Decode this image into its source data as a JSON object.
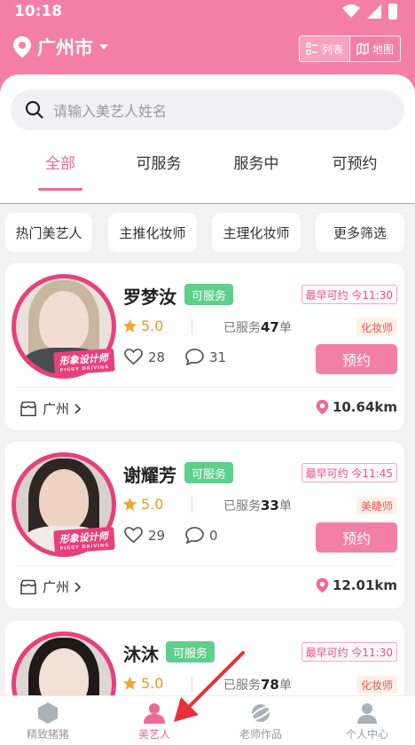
{
  "status_bar": {
    "time": "10:18"
  },
  "header": {
    "city": "广州市",
    "view_toggle": {
      "list_label": "列表",
      "map_label": "地图"
    }
  },
  "search": {
    "placeholder": "请输入美艺人姓名"
  },
  "tabs": [
    {
      "label": "全部",
      "active": true
    },
    {
      "label": "可服务",
      "active": false
    },
    {
      "label": "服务中",
      "active": false
    },
    {
      "label": "可预约",
      "active": false
    }
  ],
  "filters": [
    "热门美艺人",
    "主推化妆师",
    "主理化妆师",
    "更多筛选"
  ],
  "artists": [
    {
      "name": "罗梦汝",
      "status": "可服务",
      "earliest": "最早可约 今11:30",
      "rating": "5.0",
      "served_prefix": "已服务",
      "served_count": "47",
      "served_suffix": "单",
      "role": "化妆师",
      "likes": "28",
      "comments": "31",
      "book_label": "预约",
      "shop": "广州",
      "distance": "10.64km",
      "ribbon": "形象设计师",
      "ribbon_sub": "PIGGY DRIVING"
    },
    {
      "name": "谢耀芳",
      "status": "可服务",
      "earliest": "最早可约 今11:45",
      "rating": "5.0",
      "served_prefix": "已服务",
      "served_count": "33",
      "served_suffix": "单",
      "role": "美睫师",
      "likes": "29",
      "comments": "0",
      "book_label": "预约",
      "shop": "广州",
      "distance": "12.01km",
      "ribbon": "形象设计师",
      "ribbon_sub": "PIGGY DRIVING"
    },
    {
      "name": "沐沐",
      "status": "可服务",
      "earliest": "最早可约 今11:30",
      "rating": "5.0",
      "served_prefix": "已服务",
      "served_count": "78",
      "served_suffix": "单",
      "role": "化妆师"
    }
  ],
  "bottom_nav": [
    {
      "label": "精致猪猪",
      "icon": "hexagon-icon",
      "active": false
    },
    {
      "label": "美艺人",
      "icon": "person-icon",
      "active": true
    },
    {
      "label": "老师作品",
      "icon": "planet-icon",
      "active": false
    },
    {
      "label": "个人中心",
      "icon": "user-icon",
      "active": false
    }
  ],
  "colors": {
    "brand_pink": "#f47fa6",
    "active_pink": "#f06895",
    "available_green": "#5fcf8c",
    "arrow_red": "#e8323a"
  }
}
